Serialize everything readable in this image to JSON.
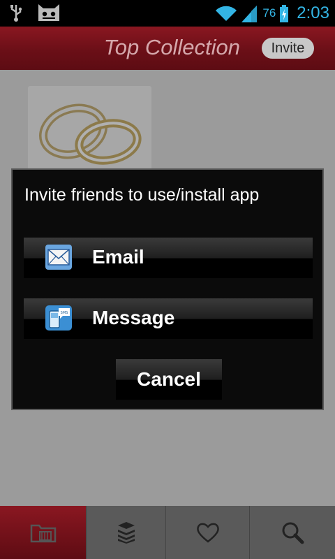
{
  "status_bar": {
    "battery_level": "76",
    "time": "2:03",
    "icons": [
      "usb-icon",
      "cyanogen-mascot-icon",
      "wifi-icon",
      "signal-icon",
      "battery-icon"
    ]
  },
  "header": {
    "title": "Top Collection",
    "invite_label": "Invite"
  },
  "dialog": {
    "title": "Invite friends to use/install app",
    "options": [
      {
        "label": "Email",
        "icon": "email-envelope-icon"
      },
      {
        "label": "Message",
        "icon": "sms-message-icon"
      }
    ],
    "cancel_label": "Cancel"
  },
  "tabbar": {
    "tabs": [
      {
        "icon": "folder-icon",
        "active": true
      },
      {
        "icon": "layers-stack-icon",
        "active": false
      },
      {
        "icon": "heart-icon",
        "active": false
      },
      {
        "icon": "search-icon",
        "active": false
      }
    ]
  },
  "colors": {
    "accent_red": "#7a121b",
    "status_blue": "#33b5e5",
    "dialog_bg": "#0b0b0b"
  }
}
